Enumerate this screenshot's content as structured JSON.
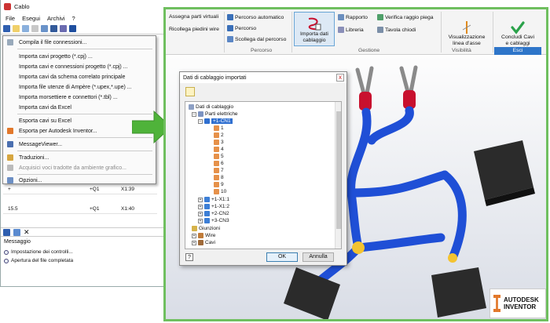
{
  "cablo": {
    "title": "Cablo",
    "menu": [
      "File",
      "Esegui",
      "Archivi",
      "?"
    ],
    "grid_rows": [
      {
        "a": "+",
        "b": "+Q1",
        "c": "X1:39"
      },
      {
        "a": "15.5",
        "b": "+Q1",
        "c": "X1:40"
      }
    ],
    "dropdown": [
      "Compila il file connessioni...",
      "Importa cavi progetto (*.cpj) ...",
      "Importa cavi e connessioni progetto (*.cpj) ...",
      "Importa cavi da schema correlato principale",
      "Importa file utenze di Ampère (*.upex,*.upe) ...",
      "Importa morsettiere e connettori (*.tbl) ...",
      "Importa cavi da Excel",
      "Esporta cavi su Excel",
      "Esporta per Autodesk Inventor...",
      "MessageViewer...",
      "Traduzioni...",
      "Acquisici voci tradotte da ambiente grafico...",
      "Opzioni..."
    ],
    "messages_title": "Messaggio",
    "messages": [
      "Impostazione dei controlli...",
      "Apertura del file completata"
    ]
  },
  "ribbon": {
    "assegna": "Assegna parti virtuali",
    "ricollega": "Ricollega piedini wire",
    "percorso_auto": "Percorso automatico",
    "percorso": "Percorso",
    "scollega": "Scollega dal percorso",
    "importa_line1": "Importa dati",
    "importa_line2": "cablaggio",
    "rapporto": "Rapporto",
    "libreria": "Libreria",
    "verifica": "Verifica raggio piega",
    "tavola": "Tavola chiodi",
    "visual_line1": "Visualizzazione",
    "visual_line2": "linea d'asse",
    "concludi_line1": "Concludi Cavi",
    "concludi_line2": "e cablaggi",
    "group_percorso": "Percorso",
    "group_gestione": "Gestione",
    "group_visibilita": "Visibilità",
    "group_esci": "Esci"
  },
  "dialog": {
    "title": "Dati di cablaggio importati",
    "close": "x",
    "tree": {
      "root": "Dati di cablaggio",
      "parti": "Parti elettriche",
      "cn1": "+1-CN1",
      "pins": [
        "1",
        "2",
        "3",
        "4",
        "5",
        "6",
        "7",
        "8",
        "9",
        "10"
      ],
      "others": [
        "+1-X1:1",
        "+1-X1:2",
        "+2-CN2",
        "+3-CN3"
      ],
      "giunzioni": "Giunzioni",
      "wire": "Wire",
      "cavi": "Cavi"
    },
    "ok": "OK",
    "annulla": "Annulla",
    "help": "?"
  },
  "brand": {
    "line1": "AUTODESK",
    "line2": "INVENTOR"
  },
  "colors": {
    "green": "#6fbf5f",
    "accent": "#2e75c9",
    "cable": "#1f4fd6",
    "connector_red": "#c8102e"
  }
}
